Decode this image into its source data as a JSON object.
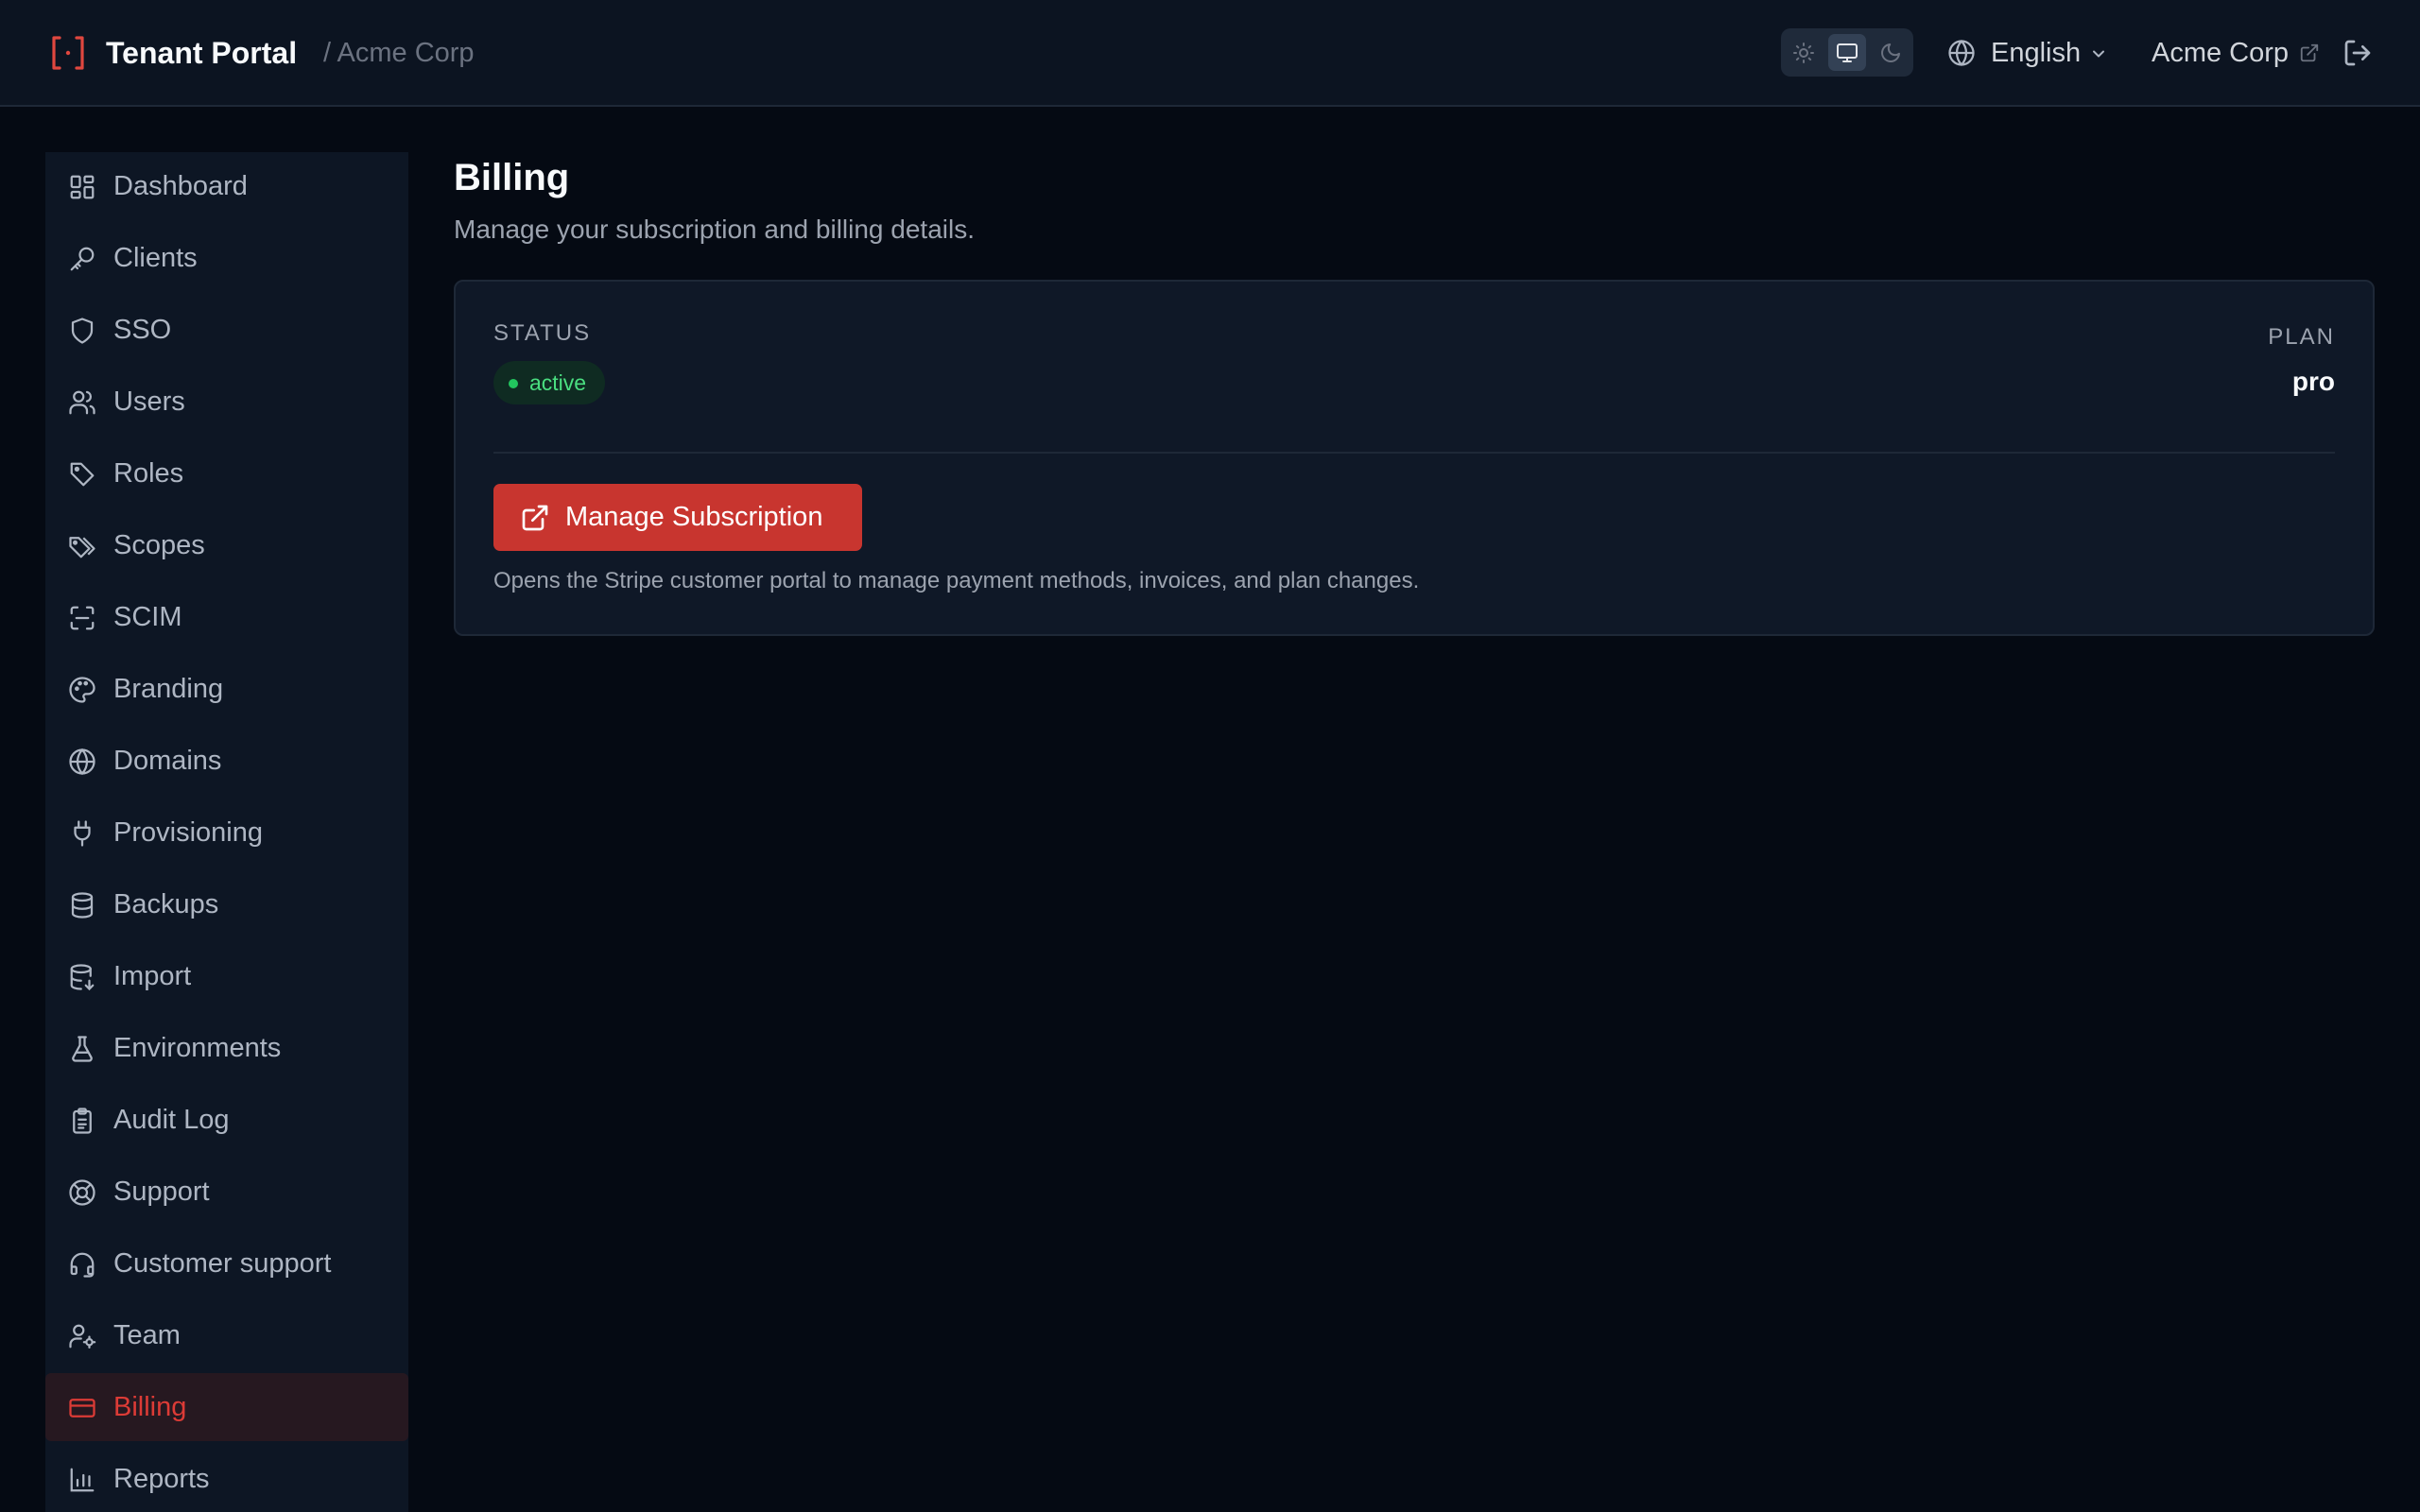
{
  "header": {
    "app_title": "Tenant Portal",
    "breadcrumb": "/ Acme Corp",
    "theme_options": [
      "light",
      "system",
      "dark"
    ],
    "theme_selected": "system",
    "language": "English",
    "org_name": "Acme Corp",
    "logo_icon": "bracket-dot-icon",
    "logout_icon": "log-out-icon"
  },
  "sidebar": {
    "items": [
      {
        "label": "Dashboard",
        "icon": "dashboard-icon"
      },
      {
        "label": "Clients",
        "icon": "key-icon"
      },
      {
        "label": "SSO",
        "icon": "shield-icon"
      },
      {
        "label": "Users",
        "icon": "users-icon"
      },
      {
        "label": "Roles",
        "icon": "tag-icon"
      },
      {
        "label": "Scopes",
        "icon": "tags-icon"
      },
      {
        "label": "SCIM",
        "icon": "scan-icon"
      },
      {
        "label": "Branding",
        "icon": "palette-icon"
      },
      {
        "label": "Domains",
        "icon": "globe-icon"
      },
      {
        "label": "Provisioning",
        "icon": "plug-icon"
      },
      {
        "label": "Backups",
        "icon": "database-icon"
      },
      {
        "label": "Import",
        "icon": "database-import-icon"
      },
      {
        "label": "Environments",
        "icon": "flask-icon"
      },
      {
        "label": "Audit Log",
        "icon": "clipboard-icon"
      },
      {
        "label": "Support",
        "icon": "life-buoy-icon"
      },
      {
        "label": "Customer support",
        "icon": "headset-icon"
      },
      {
        "label": "Team",
        "icon": "user-cog-icon"
      },
      {
        "label": "Billing",
        "icon": "credit-card-icon",
        "active": true
      },
      {
        "label": "Reports",
        "icon": "bar-chart-icon"
      }
    ]
  },
  "main": {
    "title": "Billing",
    "subtitle": "Manage your subscription and billing details.",
    "card": {
      "status_label": "STATUS",
      "status_value": "active",
      "plan_label": "PLAN",
      "plan_value": "pro",
      "button_label": "Manage Subscription",
      "help_text": "Opens the Stripe customer portal to manage payment methods, invoices, and plan changes."
    }
  },
  "colors": {
    "accent": "#c8352f",
    "active_text": "#dc3b36",
    "success": "#22c55e",
    "background": "#050a13"
  }
}
